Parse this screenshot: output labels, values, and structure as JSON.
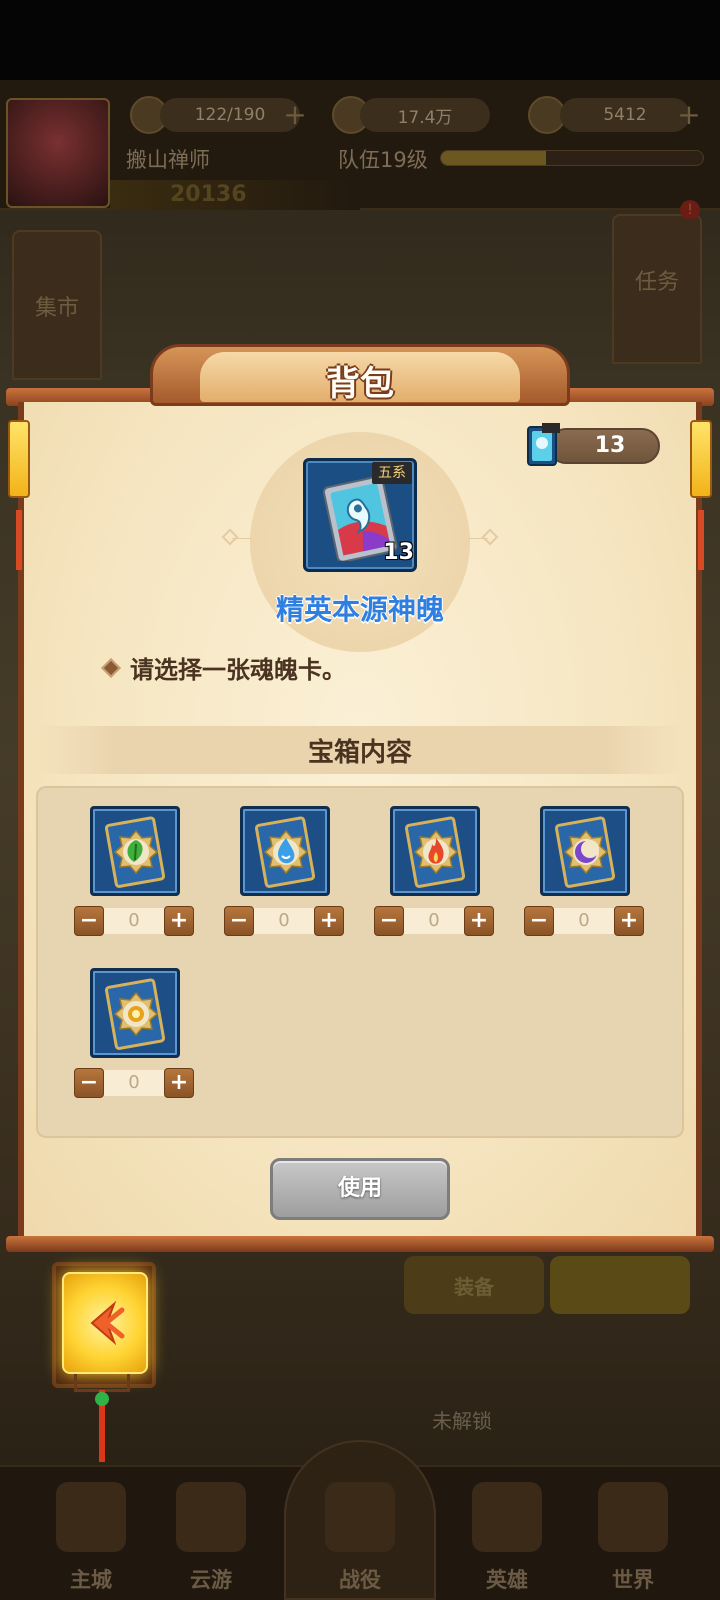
{
  "hud": {
    "player_name": "搬山禅师",
    "stamina": "122/190",
    "coins": "17.4万",
    "gems": "5412",
    "team_level": "队伍19级",
    "team_progress": 0.4,
    "power": "20136"
  },
  "background": {
    "left_button": "集市",
    "right_button": "任务",
    "tab_equip": "装备",
    "locked_label": "未解锁",
    "nav": [
      "主城",
      "云游",
      "战役",
      "英雄",
      "世界"
    ]
  },
  "dialog": {
    "title": "背包",
    "owned_count": "13",
    "item_tag": "五系",
    "item_count": "13",
    "item_name": "精英本源神魄",
    "hint": "请选择一张魂魄卡。",
    "section_title": "宝箱内容",
    "choices": [
      {
        "element": "wood",
        "icon": "leaf-icon",
        "color": "#3fae3a",
        "value": "0"
      },
      {
        "element": "water",
        "icon": "water-icon",
        "color": "#3a9ee8",
        "value": "0"
      },
      {
        "element": "fire",
        "icon": "fire-icon",
        "color": "#e8482a",
        "value": "0"
      },
      {
        "element": "dark",
        "icon": "moon-icon",
        "color": "#7b46c9",
        "value": "0"
      },
      {
        "element": "light",
        "icon": "sun-icon",
        "color": "#e8a21a",
        "value": "0"
      }
    ],
    "minus": "−",
    "plus": "+",
    "use_label": "使用"
  },
  "colors": {
    "accent_gold": "#ffd433",
    "frame_brown": "#7a3c1c",
    "name_blue": "#2f7fe0"
  }
}
